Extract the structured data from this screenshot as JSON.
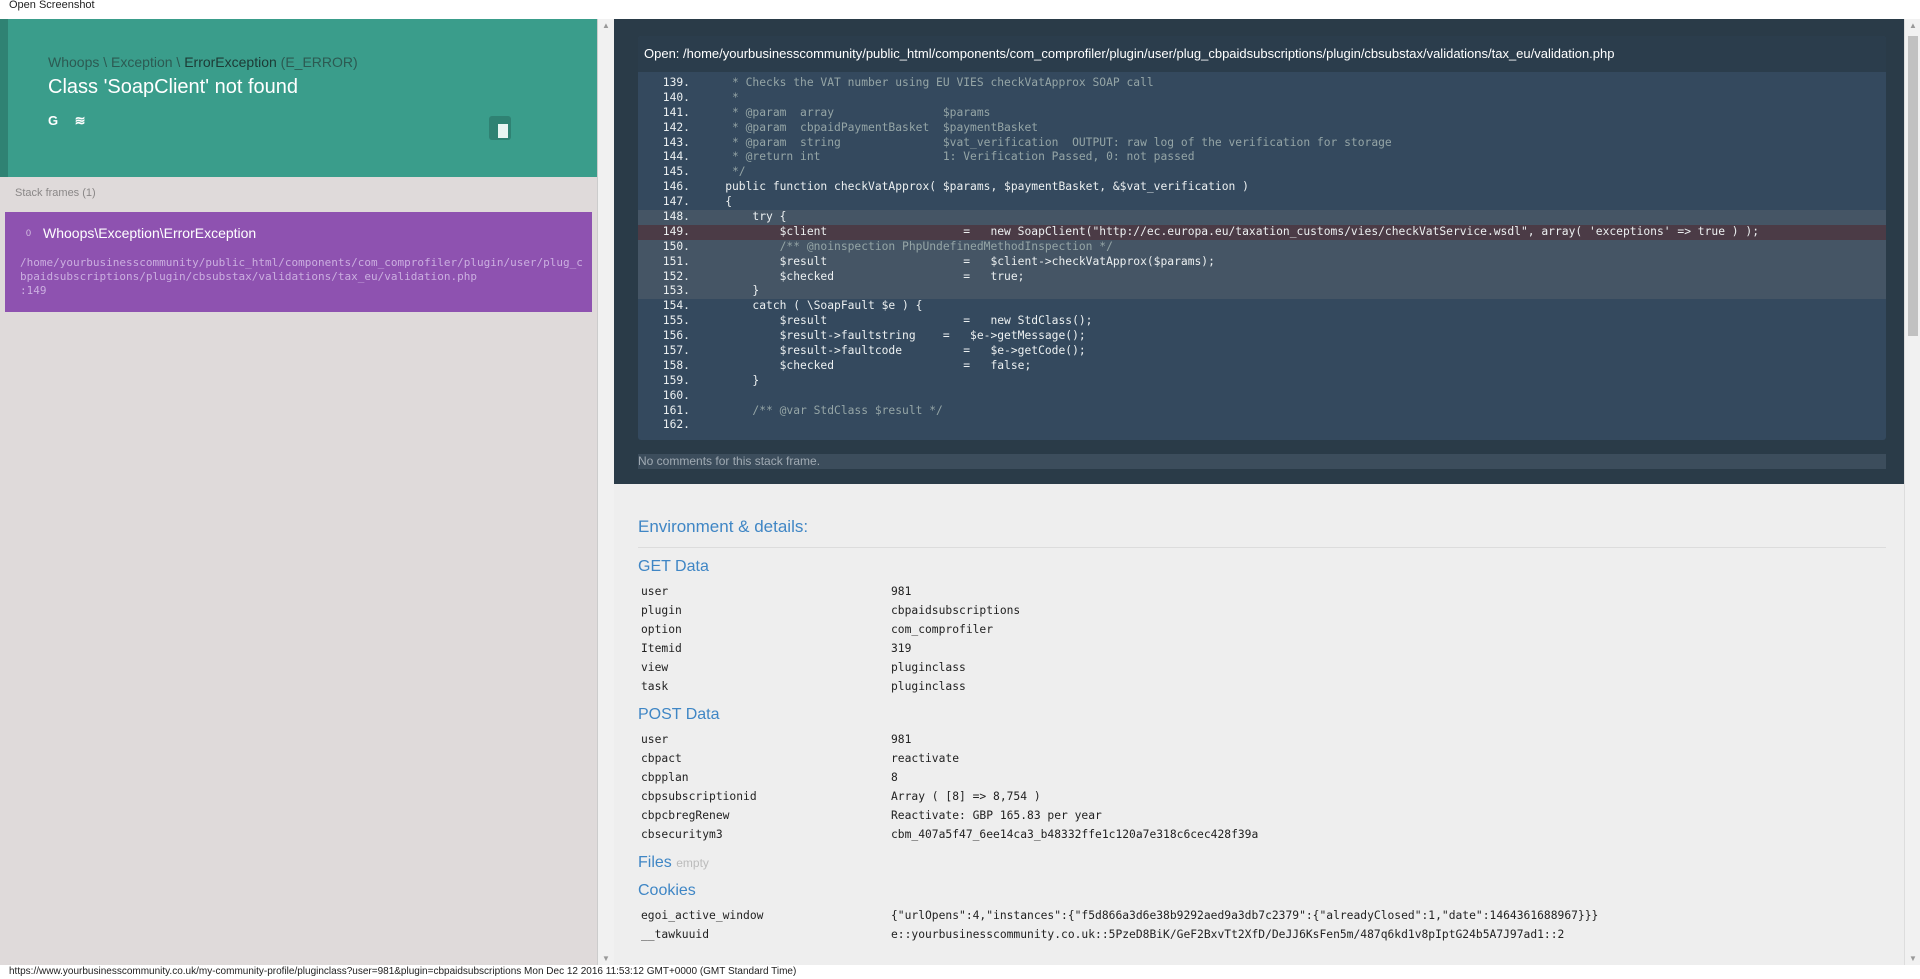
{
  "window": {
    "title": "Open Screenshot"
  },
  "header": {
    "exception_path_1": "Whoops",
    "exception_path_2": "Exception",
    "exception_path_3": "ErrorException",
    "exception_code": "(E_ERROR)",
    "message": "Class 'SoapClient' not found",
    "google_icon_glyph": "G",
    "stack_icon_glyph": "≋"
  },
  "stack": {
    "title": "Stack frames (1)",
    "frames": [
      {
        "index": "0",
        "class": "Whoops\\Exception\\ErrorException",
        "path": "/home/yourbusinesscommunity/public_html/components/com_comprofiler/plugin/user/plug_cbpaidsubscriptions/plugin/cbsubstax/validations/tax_eu/validation.php",
        "line": ":149"
      }
    ]
  },
  "code": {
    "open_label": "Open: /home/yourbusinesscommunity/public_html/components/com_comprofiler/plugin/user/plug_cbpaidsubscriptions/plugin/cbsubstax/validations/tax_eu/validation.php",
    "lines": [
      {
        "n": "139.",
        "t": "     * Checks the VAT number using EU VIES checkVatApprox SOAP call"
      },
      {
        "n": "140.",
        "t": "     *"
      },
      {
        "n": "141.",
        "t": "     * @param  array                $params"
      },
      {
        "n": "142.",
        "t": "     * @param  cbpaidPaymentBasket  $paymentBasket"
      },
      {
        "n": "143.",
        "t": "     * @param  string               $vat_verification  OUTPUT: raw log of the verification for storage"
      },
      {
        "n": "144.",
        "t": "     * @return int                  1: Verification Passed, 0: not passed"
      },
      {
        "n": "145.",
        "t": "     */"
      },
      {
        "n": "146.",
        "t": "    public function checkVatApprox( $params, $paymentBasket, &$vat_verification )"
      },
      {
        "n": "147.",
        "t": "    {"
      },
      {
        "n": "148.",
        "t": "        try {"
      },
      {
        "n": "149.",
        "t": "            $client                    =   new SoapClient(\"http://ec.europa.eu/taxation_customs/vies/checkVatService.wsdl\", array( 'exceptions' => true ) );"
      },
      {
        "n": "150.",
        "t": "            /** @noinspection PhpUndefinedMethodInspection */"
      },
      {
        "n": "151.",
        "t": "            $result                    =   $client->checkVatApprox($params);"
      },
      {
        "n": "152.",
        "t": "            $checked                   =   true;"
      },
      {
        "n": "153.",
        "t": "        }"
      },
      {
        "n": "154.",
        "t": "        catch ( \\SoapFault $e ) {"
      },
      {
        "n": "155.",
        "t": "            $result                    =   new StdClass();"
      },
      {
        "n": "156.",
        "t": "            $result->faultstring    =   $e->getMessage();"
      },
      {
        "n": "157.",
        "t": "            $result->faultcode         =   $e->getCode();"
      },
      {
        "n": "158.",
        "t": "            $checked                   =   false;"
      },
      {
        "n": "159.",
        "t": "        }"
      },
      {
        "n": "160.",
        "t": ""
      },
      {
        "n": "161.",
        "t": "        /** @var StdClass $result */"
      },
      {
        "n": "162.",
        "t": ""
      }
    ],
    "comments_text": "No comments for this stack frame."
  },
  "env": {
    "title": "Environment & details:",
    "get": {
      "title": "GET Data",
      "rows": [
        {
          "k": "user",
          "v": "981"
        },
        {
          "k": "plugin",
          "v": "cbpaidsubscriptions"
        },
        {
          "k": "option",
          "v": "com_comprofiler"
        },
        {
          "k": "Itemid",
          "v": "319"
        },
        {
          "k": "view",
          "v": "pluginclass"
        },
        {
          "k": "task",
          "v": "pluginclass"
        }
      ]
    },
    "post": {
      "title": "POST Data",
      "rows": [
        {
          "k": "user",
          "v": "981"
        },
        {
          "k": "cbpact",
          "v": "reactivate"
        },
        {
          "k": "cbpplan",
          "v": "8"
        },
        {
          "k": "cbpsubscriptionid",
          "v": "Array ( [8] => 8,754 )"
        },
        {
          "k": "cbpcbregRenew",
          "v": "Reactivate: GBP 165.83 per year"
        },
        {
          "k": "cbsecuritym3",
          "v": "cbm_407a5f47_6ee14ca3_b48332ffe1c120a7e318c6cec428f39a"
        }
      ]
    },
    "files": {
      "title": "Files",
      "empty_label": "empty"
    },
    "cookies": {
      "title": "Cookies",
      "rows": [
        {
          "k": "egoi_active_window",
          "v": "{\"urlOpens\":4,\"instances\":{\"f5d866a3d6e38b9292aed9a3db7c2379\":{\"alreadyClosed\":1,\"date\":1464361688967}}}"
        },
        {
          "k": "__tawkuuid",
          "v": "e::yourbusinesscommunity.co.uk::5PzeD8BiK/GeF2BxvTt2XfD/DeJJ6KsFen5m/487q6kd1v8pIptG24b5A7J97ad1::2"
        }
      ]
    }
  },
  "status": {
    "text": "https://www.yourbusinesscommunity.co.uk/my-community-profile/pluginclass?user=981&plugin=cbpaidsubscriptions Mon Dec 12 2016 11:53:12 GMT+0000 (GMT Standard Time)"
  },
  "colors": {
    "header_bg": "#3a9d8b",
    "frame_active_bg": "#8e52b0",
    "code_bg": "#34495e",
    "accent_blue": "#3f86c5"
  }
}
